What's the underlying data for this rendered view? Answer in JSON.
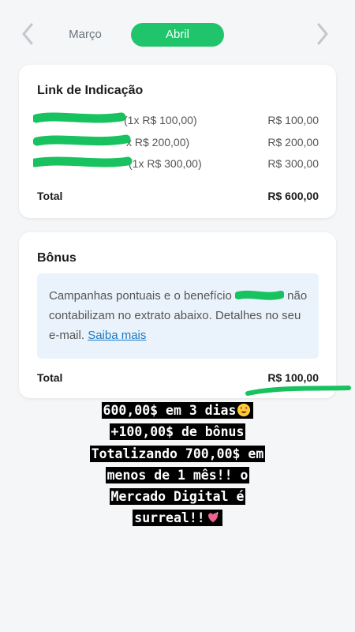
{
  "header": {
    "prev_month": "Março",
    "active_month": "Abril",
    "left_arrow_icon": "chevron-left-icon",
    "right_arrow_icon": "chevron-right-icon"
  },
  "referral": {
    "title": "Link de Indicação",
    "items": [
      {
        "desc": "(1x R$ 100,00)",
        "amount": "R$ 100,00"
      },
      {
        "desc": "x R$ 200,00)",
        "amount": "R$ 200,00"
      },
      {
        "desc": "(1x R$ 300,00)",
        "amount": "R$ 300,00"
      }
    ],
    "total_label": "Total",
    "total_value": "R$ 600,00"
  },
  "bonus": {
    "title": "Bônus",
    "info_text_1": "Campanhas pontuais e o benefício",
    "info_text_2": "não contabilizam no extrato abaixo. Detalhes no seu e-mail.",
    "info_link": "Saiba mais",
    "total_label": "Total",
    "total_value": "R$ 100,00"
  },
  "overlay": {
    "lines": [
      "600,00$ em 3 dias",
      "+100,00$ de bônus",
      "Totalizando 700,00$ em",
      "menos de 1 mês!! o",
      "Mercado Digital é",
      "surreal!!"
    ],
    "emoji_1": "heart-eyes-emoji",
    "emoji_2": "sparkling-heart-emoji"
  },
  "colors": {
    "accent": "#1fc46b",
    "scribble": "#17c25f",
    "link": "#1b79c4",
    "info_bg": "#eaf3fb"
  }
}
